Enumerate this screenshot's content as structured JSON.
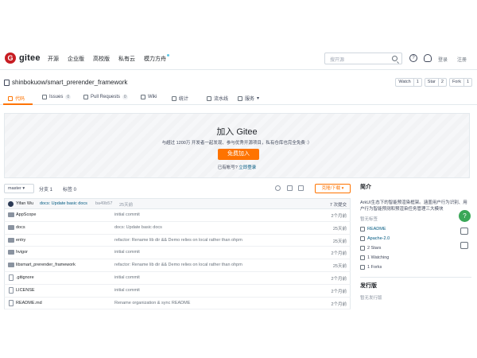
{
  "brand": {
    "logo_letter": "G",
    "name": "gitee"
  },
  "nav": [
    "开源",
    "企业版",
    "高校版",
    "私有云",
    "模力方舟"
  ],
  "search": {
    "placeholder": "搜开源"
  },
  "user_links": {
    "login": "登录",
    "register": "注册"
  },
  "repo": {
    "path": "shinbokuow/smart_prerender_framework",
    "watch": {
      "label": "Watch",
      "count": "1"
    },
    "star": {
      "label": "Star",
      "count": "2"
    },
    "fork": {
      "label": "Fork",
      "count": "1"
    }
  },
  "tabs": [
    {
      "label": "代码",
      "badge": ""
    },
    {
      "label": "Issues",
      "badge": "0"
    },
    {
      "label": "Pull Requests",
      "badge": "0"
    },
    {
      "label": "Wiki",
      "badge": ""
    },
    {
      "label": "统计",
      "badge": ""
    },
    {
      "label": "流水线",
      "badge": ""
    },
    {
      "label": "服务",
      "badge": ""
    }
  ],
  "banner": {
    "title": "加入 Gitee",
    "desc": "与超过 1200万 开发者一起发现、参与优秀开源项目，私有仓库也完全免费 :）",
    "button": "免费加入",
    "login_prompt": "已有帐号?",
    "login_link": "立即登录"
  },
  "toolbar": {
    "branch": "master",
    "branches": "分支 1",
    "tags": "标签 0",
    "clone": "克隆/下载"
  },
  "last_commit": {
    "author": "Yifan Wu",
    "message": "docs: Update basic docs",
    "hash": "ba49b57",
    "time": "25天前",
    "count": "7 次提交"
  },
  "files": [
    {
      "name": "AppScope",
      "type": "folder",
      "message": "initial commit",
      "time": "2个月前"
    },
    {
      "name": "docs",
      "type": "folder",
      "message": "docs: Update basic docs",
      "time": "25天前"
    },
    {
      "name": "entry",
      "type": "folder",
      "message": "refactor: Rename lib dir && Demo relies on local rather than ohpm",
      "time": "25天前"
    },
    {
      "name": "hvigor",
      "type": "folder",
      "message": "initial commit",
      "time": "2个月前"
    },
    {
      "name": "libsmart_prerender_framework",
      "type": "folder",
      "message": "refactor: Rename lib dir && Demo relies on local rather than ohpm",
      "time": "25天前"
    },
    {
      "name": ".gitignore",
      "type": "file",
      "message": "initial commit",
      "time": "2个月前"
    },
    {
      "name": "LICENSE",
      "type": "file",
      "message": "initial commit",
      "time": "2个月前"
    },
    {
      "name": "README.md",
      "type": "file",
      "message": "Rename organization & sync README",
      "time": "2个月前"
    }
  ],
  "sidebar": {
    "intro_title": "简介",
    "intro": "ArkUI生态下的智能预渲染框架。涵盖用户行为识别、用户行为智能预测和预渲染任务管理三大模块",
    "no_tags": "暂无标签",
    "readme": "README",
    "license": "Apache-2.0",
    "stars": "2 Stars",
    "watching": "1 Watching",
    "forks": "1 Forks",
    "release_title": "发行版",
    "no_release": "暂无发行版"
  },
  "colors": {
    "accent": "#fe7300",
    "brand_red": "#c71d23",
    "link": "#005980",
    "help": "#3aa757"
  }
}
